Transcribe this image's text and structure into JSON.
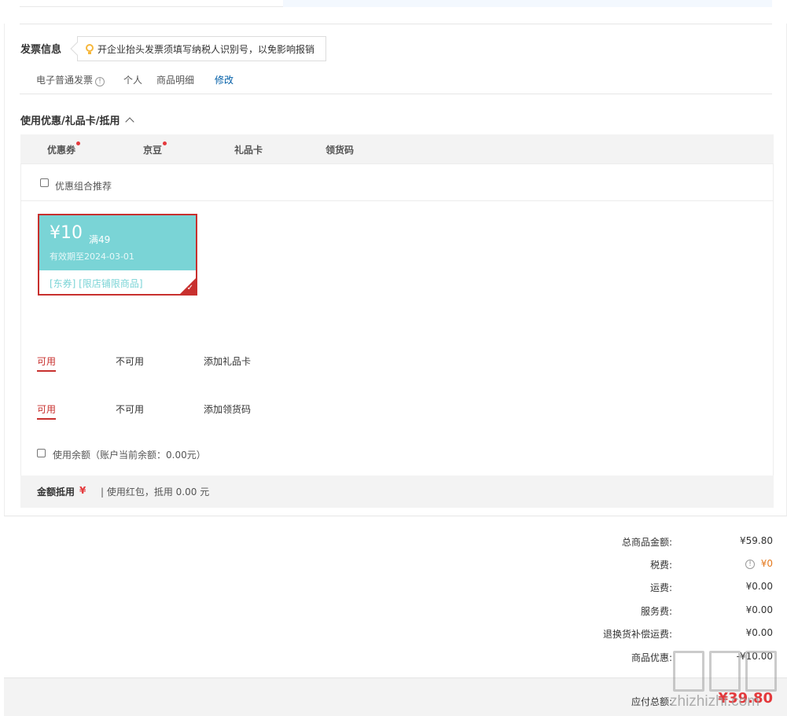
{
  "invoice": {
    "title": "发票信息",
    "tip": "开企业抬头发票须填写纳税人识别号，以免影响报销",
    "type": "电子普通发票",
    "info_glyph": "!",
    "holder": "个人",
    "content": "商品明细",
    "modify_label": "修改"
  },
  "discount": {
    "title": "使用优惠/礼品卡/抵用",
    "tabs": [
      {
        "label": "优惠券",
        "has_dot": true
      },
      {
        "label": "京豆",
        "has_dot": true
      },
      {
        "label": "礼品卡",
        "has_dot": false
      },
      {
        "label": "领货码",
        "has_dot": false
      }
    ],
    "combo_label": "优惠组合推荐",
    "coupon": {
      "amount": "¥10",
      "condition": "满49",
      "expire": "有效期至2024-03-01",
      "desc": "[东券] [限店铺限商品]",
      "selected": true,
      "check_glyph": "✓"
    },
    "giftcard_row": {
      "available": "可用",
      "unavailable": "不可用",
      "add": "添加礼品卡"
    },
    "pickup_row": {
      "available": "可用",
      "unavailable": "不可用",
      "add": "添加领货码"
    },
    "balance_label": "使用余额（账户当前余额：0.00元）",
    "deduct_label": "金额抵用",
    "deduct_currency": "¥",
    "deduct_info": "| 使用红包，抵用 0.00 元"
  },
  "summary": {
    "rows": [
      {
        "label": "总商品金额:",
        "value": "¥59.80"
      },
      {
        "label": "税费:",
        "value": "¥0"
      },
      {
        "label": "运费:",
        "value": "¥0.00"
      },
      {
        "label": "服务费:",
        "value": "¥0.00"
      },
      {
        "label": "退换货补偿运费:",
        "value": "¥0.00"
      },
      {
        "label": "商品优惠:",
        "value": "-¥10.00"
      }
    ],
    "tax_info_glyph": "!",
    "total_label": "应付总额:",
    "total_value": "¥39.80"
  },
  "watermark": {
    "text": "zhizhizhi.com",
    "logo": "值值值"
  },
  "colors": {
    "accent_red": "#e4393c",
    "coupon_teal": "#7ad4d6",
    "link_blue": "#005ea7"
  }
}
